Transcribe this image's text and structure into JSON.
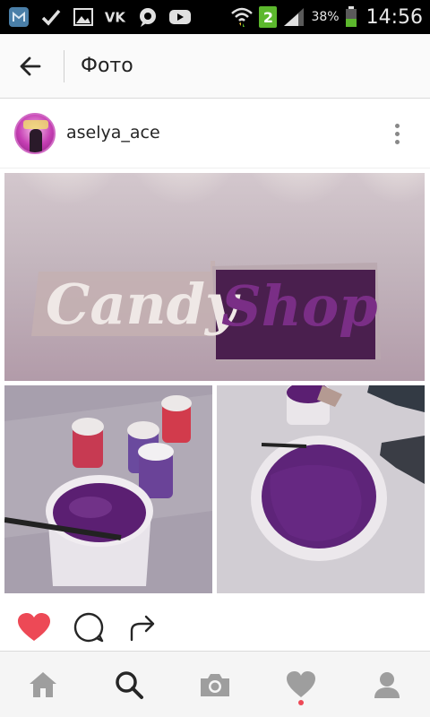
{
  "status_bar": {
    "battery_percent": "38%",
    "time": "14:56",
    "sim_slot": "2",
    "icons": [
      "m-app-icon",
      "check-icon",
      "gallery-icon",
      "vk-icon",
      "chat-icon",
      "youtube-icon",
      "wifi-icon",
      "signal-icon",
      "battery-icon"
    ]
  },
  "header": {
    "title": "Фото",
    "back_icon": "arrow-left-icon"
  },
  "post": {
    "username": "aselya_ace",
    "photo_text_left": "Candy",
    "photo_text_right": "Shop"
  },
  "actions": {
    "icons": [
      "heart-icon",
      "comment-icon",
      "share-icon"
    ],
    "liked": true,
    "like_color": "#ed4956"
  },
  "bottom_nav": {
    "items": [
      "home-icon",
      "search-icon",
      "camera-icon",
      "activity-icon",
      "profile-icon"
    ],
    "active": "search-icon"
  }
}
